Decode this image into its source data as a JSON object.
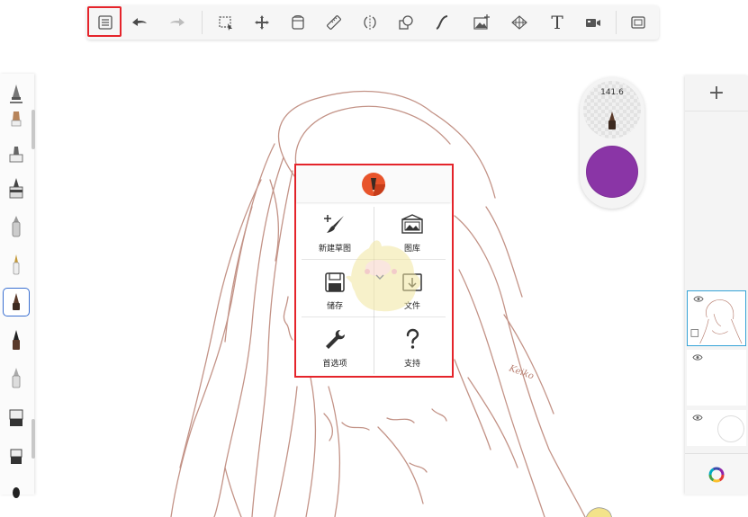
{
  "toolbar": {
    "items": [
      {
        "name": "menu-list-icon",
        "highlighted": true
      },
      {
        "name": "undo-icon"
      },
      {
        "name": "redo-icon"
      },
      {
        "name": "selection-icon"
      },
      {
        "name": "move-icon"
      },
      {
        "name": "fill-bucket-icon"
      },
      {
        "name": "ruler-icon"
      },
      {
        "name": "symmetry-icon"
      },
      {
        "name": "shapes-icon"
      },
      {
        "name": "curve-icon"
      },
      {
        "name": "add-image-icon"
      },
      {
        "name": "perspective-icon"
      },
      {
        "name": "text-icon"
      },
      {
        "name": "timelapse-icon"
      },
      {
        "name": "fullscreen-icon"
      }
    ],
    "text_tool_label": "T"
  },
  "brush_palette": {
    "brushes": [
      "pencil",
      "marker",
      "pen",
      "inking",
      "airbrush",
      "paint",
      "calligraphy-brush",
      "brush",
      "smudge",
      "eraser",
      "stamp",
      "flat-brush",
      "round-brush"
    ],
    "selected_brush": "calligraphy-brush"
  },
  "brush_puck": {
    "size_value": "141.6",
    "color": "#8a35a6"
  },
  "main_menu": {
    "items": [
      {
        "label": "新建草图",
        "icon": "new-sketch-icon"
      },
      {
        "label": "图库",
        "icon": "gallery-icon"
      },
      {
        "label": "储存",
        "icon": "save-icon"
      },
      {
        "label": "文件",
        "icon": "file-icon"
      },
      {
        "label": "首选项",
        "icon": "wrench-icon"
      },
      {
        "label": "支持",
        "icon": "question-icon"
      }
    ]
  },
  "layers": {
    "add_label": "+",
    "items": [
      {
        "name": "sketch-layer",
        "selected": true
      },
      {
        "name": "empty-layer",
        "selected": false
      },
      {
        "name": "background-layer",
        "selected": false
      }
    ]
  },
  "canvas": {
    "signature": "Keiko"
  },
  "colors": {
    "highlight": "#e5242b",
    "selected_border": "#3a6fd1",
    "layer_selected": "#35a3d7",
    "sketch_stroke": "#b0776a"
  }
}
